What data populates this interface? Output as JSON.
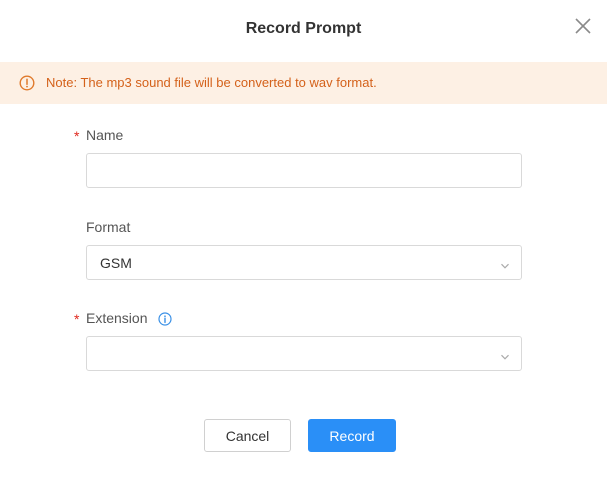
{
  "dialog": {
    "title": "Record Prompt",
    "close_icon": "close-icon"
  },
  "notice": {
    "icon": "warning-circle-icon",
    "text": "Note: The mp3 sound file will be converted to wav format.",
    "color": "#d4611a",
    "background": "#fdf0e4"
  },
  "form": {
    "name": {
      "label": "Name",
      "required_marker": "*",
      "value": ""
    },
    "format": {
      "label": "Format",
      "value": "GSM"
    },
    "extension": {
      "label": "Extension",
      "required_marker": "*",
      "info_icon": "info-icon",
      "value": ""
    }
  },
  "actions": {
    "cancel_label": "Cancel",
    "record_label": "Record",
    "primary_color": "#2a8ff7"
  }
}
